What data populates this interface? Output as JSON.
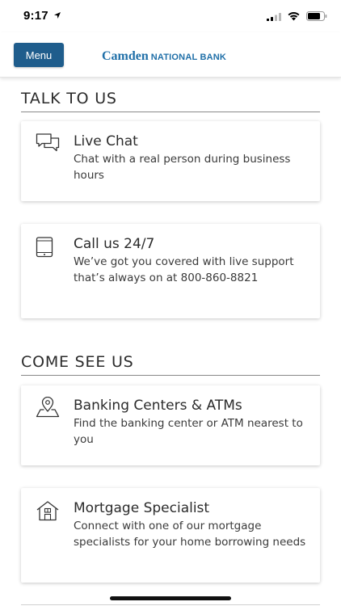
{
  "status_bar": {
    "time": "9:17"
  },
  "header": {
    "menu_label": "Menu",
    "logo_primary": "Camden",
    "logo_secondary": "NATIONAL BANK"
  },
  "sections": [
    {
      "title": "TALK TO US",
      "cards": [
        {
          "icon": "chat-bubbles-icon",
          "title": "Live Chat",
          "description": "Chat with a real person during business hours"
        },
        {
          "icon": "phone-icon",
          "title": "Call us 24/7",
          "description": "We’ve got you covered with live support that’s always on at 800-860-8821"
        }
      ]
    },
    {
      "title": "COME SEE US",
      "cards": [
        {
          "icon": "location-pin-icon",
          "title": "Banking Centers & ATMs",
          "description": "Find the banking center or ATM nearest to you"
        },
        {
          "icon": "house-icon",
          "title": "Mortgage Specialist",
          "description": "Connect with one of our mortgage specialists for your home borrowing needs"
        }
      ]
    }
  ]
}
